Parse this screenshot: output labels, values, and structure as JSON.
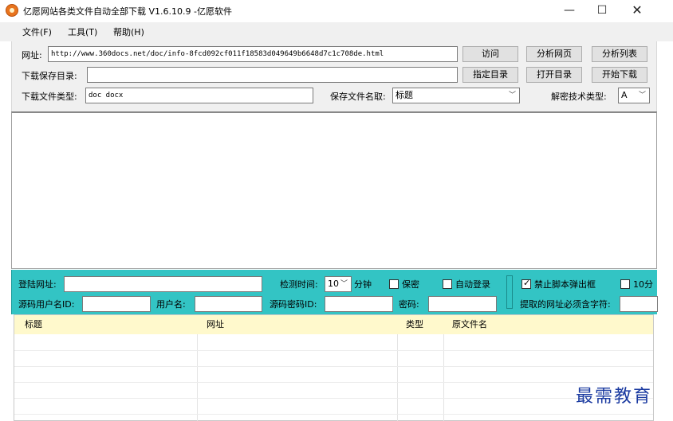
{
  "window": {
    "title": "亿愿网站各类文件自动全部下载 V1.6.10.9 -亿愿软件",
    "minimize": "—",
    "maximize": "☐",
    "close": "✕"
  },
  "menu": [
    {
      "label": "文件(F)"
    },
    {
      "label": "工具(T)"
    },
    {
      "label": "帮助(H)"
    }
  ],
  "toolbar": {
    "url_label": "网址:",
    "url_value": "http://www.360docs.net/doc/info-8fcd092cf011f18583d049649b6648d7c1c708de.html",
    "visit_button": "访问",
    "analyze_page_button": "分析网页",
    "analyze_list_button": "分析列表",
    "save_dir_label": "下载保存目录:",
    "save_dir_value": "",
    "choose_dir_button": "指定目录",
    "open_dir_button": "打开目录",
    "start_download_button": "开始下载",
    "file_type_label": "下载文件类型:",
    "file_type_value": "doc docx",
    "save_name_label": "保存文件名取:",
    "save_name_value": "标题",
    "decrypt_label": "解密技术类型:",
    "decrypt_value": "A"
  },
  "login": {
    "login_url_label": "登陆网址:",
    "interval_label": "检测时间:",
    "interval_value": "10",
    "interval_unit": "分钟",
    "keep_secret_label": "保密",
    "auto_login_label": "自动登录",
    "block_popup_label": "禁止脚本弹出框",
    "ten_label": "10分",
    "user_id_label": "源码用户名ID:",
    "username_label": "用户名:",
    "password_id_label": "源码密码ID:",
    "password_label": "密码:",
    "must_contain_label": "提取的网址必须含字符:"
  },
  "table": {
    "columns": [
      "标题",
      "网址",
      "类型",
      "原文件名"
    ]
  },
  "watermark": "最需教育",
  "colors": {
    "teal_panel": "#33c4c4",
    "grid_header": "#fff9cc",
    "watermark": "#1a3aa0"
  }
}
